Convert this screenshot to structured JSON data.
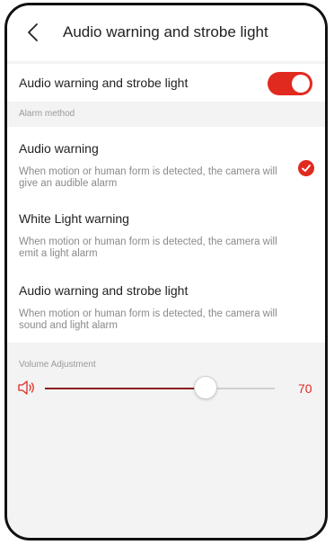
{
  "header": {
    "title": "Audio warning and strobe light"
  },
  "toggle": {
    "label": "Audio warning and strobe light",
    "enabled": true
  },
  "alarm_method": {
    "section_label": "Alarm method",
    "options": [
      {
        "title": "Audio warning",
        "description": "When motion or human form is detected, the camera will give an audible alarm",
        "selected": true
      },
      {
        "title": "White Light warning",
        "description": "When motion or human form is detected, the camera will emit a light alarm",
        "selected": false
      },
      {
        "title": "Audio warning and strobe light",
        "description": "When motion or human form is detected, the camera will sound and light alarm",
        "selected": false
      }
    ]
  },
  "volume": {
    "section_label": "Volume Adjustment",
    "value": "70",
    "level_fraction": 0.7
  },
  "colors": {
    "accent": "#e02a20",
    "slider_fill": "#8c1e1e",
    "background": "#f3f3f3"
  },
  "icons": {
    "back": "back-arrow-icon",
    "speaker": "speaker-icon",
    "check": "checkmark-icon"
  }
}
